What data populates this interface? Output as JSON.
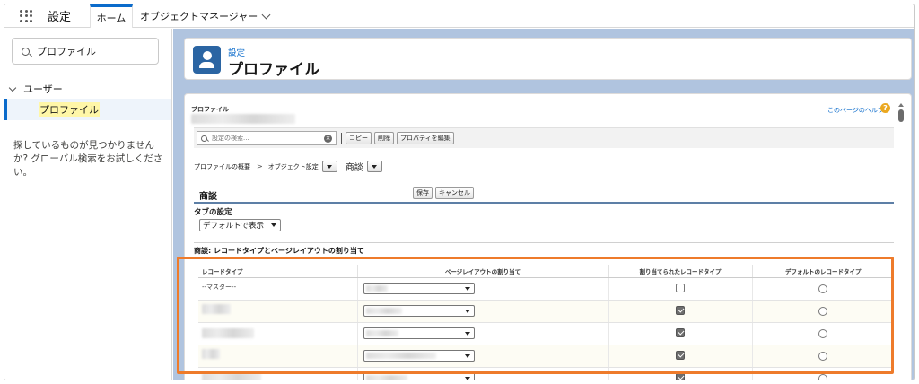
{
  "topnav": {
    "app_name": "設定",
    "tabs": [
      {
        "label": "ホーム"
      },
      {
        "label": "オブジェクトマネージャー"
      }
    ]
  },
  "sidebar": {
    "search_value": "プロファイル",
    "tree": {
      "group": "ユーザー",
      "item": "プロファイル"
    },
    "no_result_text": "探しているものが見つかりませんか? グローバル検索をお試しください。"
  },
  "header": {
    "subtitle": "設定",
    "title": "プロファイル",
    "icon": "user-icon"
  },
  "content": {
    "crumb_label": "プロファイル",
    "help_link": "このページのヘルプ",
    "toolbar": {
      "search_placeholder": "設定の検索...",
      "buttons": [
        "コピー",
        "削除",
        "プロパティを編集"
      ]
    },
    "breadcrumb": {
      "overview": "プロファイルの概要",
      "separator": ">",
      "object_settings": "オブジェクト設定",
      "object": "商談"
    },
    "object_section": {
      "title": "商談",
      "save": "保存",
      "cancel": "キャンセル"
    },
    "tab_settings": {
      "label": "タブの設定",
      "value": "デフォルトで表示"
    },
    "record_type_section": "商談: レコードタイプとページレイアウトの割り当て",
    "table": {
      "headers": [
        "レコードタイプ",
        "ページレイアウトの割り当て",
        "割り当てられたレコードタイプ",
        "デフォルトのレコードタイプ"
      ],
      "rows": [
        {
          "name": "--マスター--",
          "assigned": false,
          "default": false
        },
        {
          "name": "",
          "assigned": true,
          "default": false
        },
        {
          "name": "",
          "assigned": true,
          "default": false
        },
        {
          "name": "",
          "assigned": true,
          "default": false
        },
        {
          "name": "",
          "assigned": true,
          "default": false
        }
      ]
    }
  },
  "colors": {
    "accent": "#0b6bcb",
    "highlight_border": "#ee7b2b",
    "main_background": "#b0c4df",
    "header_icon": "#2b65a3"
  }
}
